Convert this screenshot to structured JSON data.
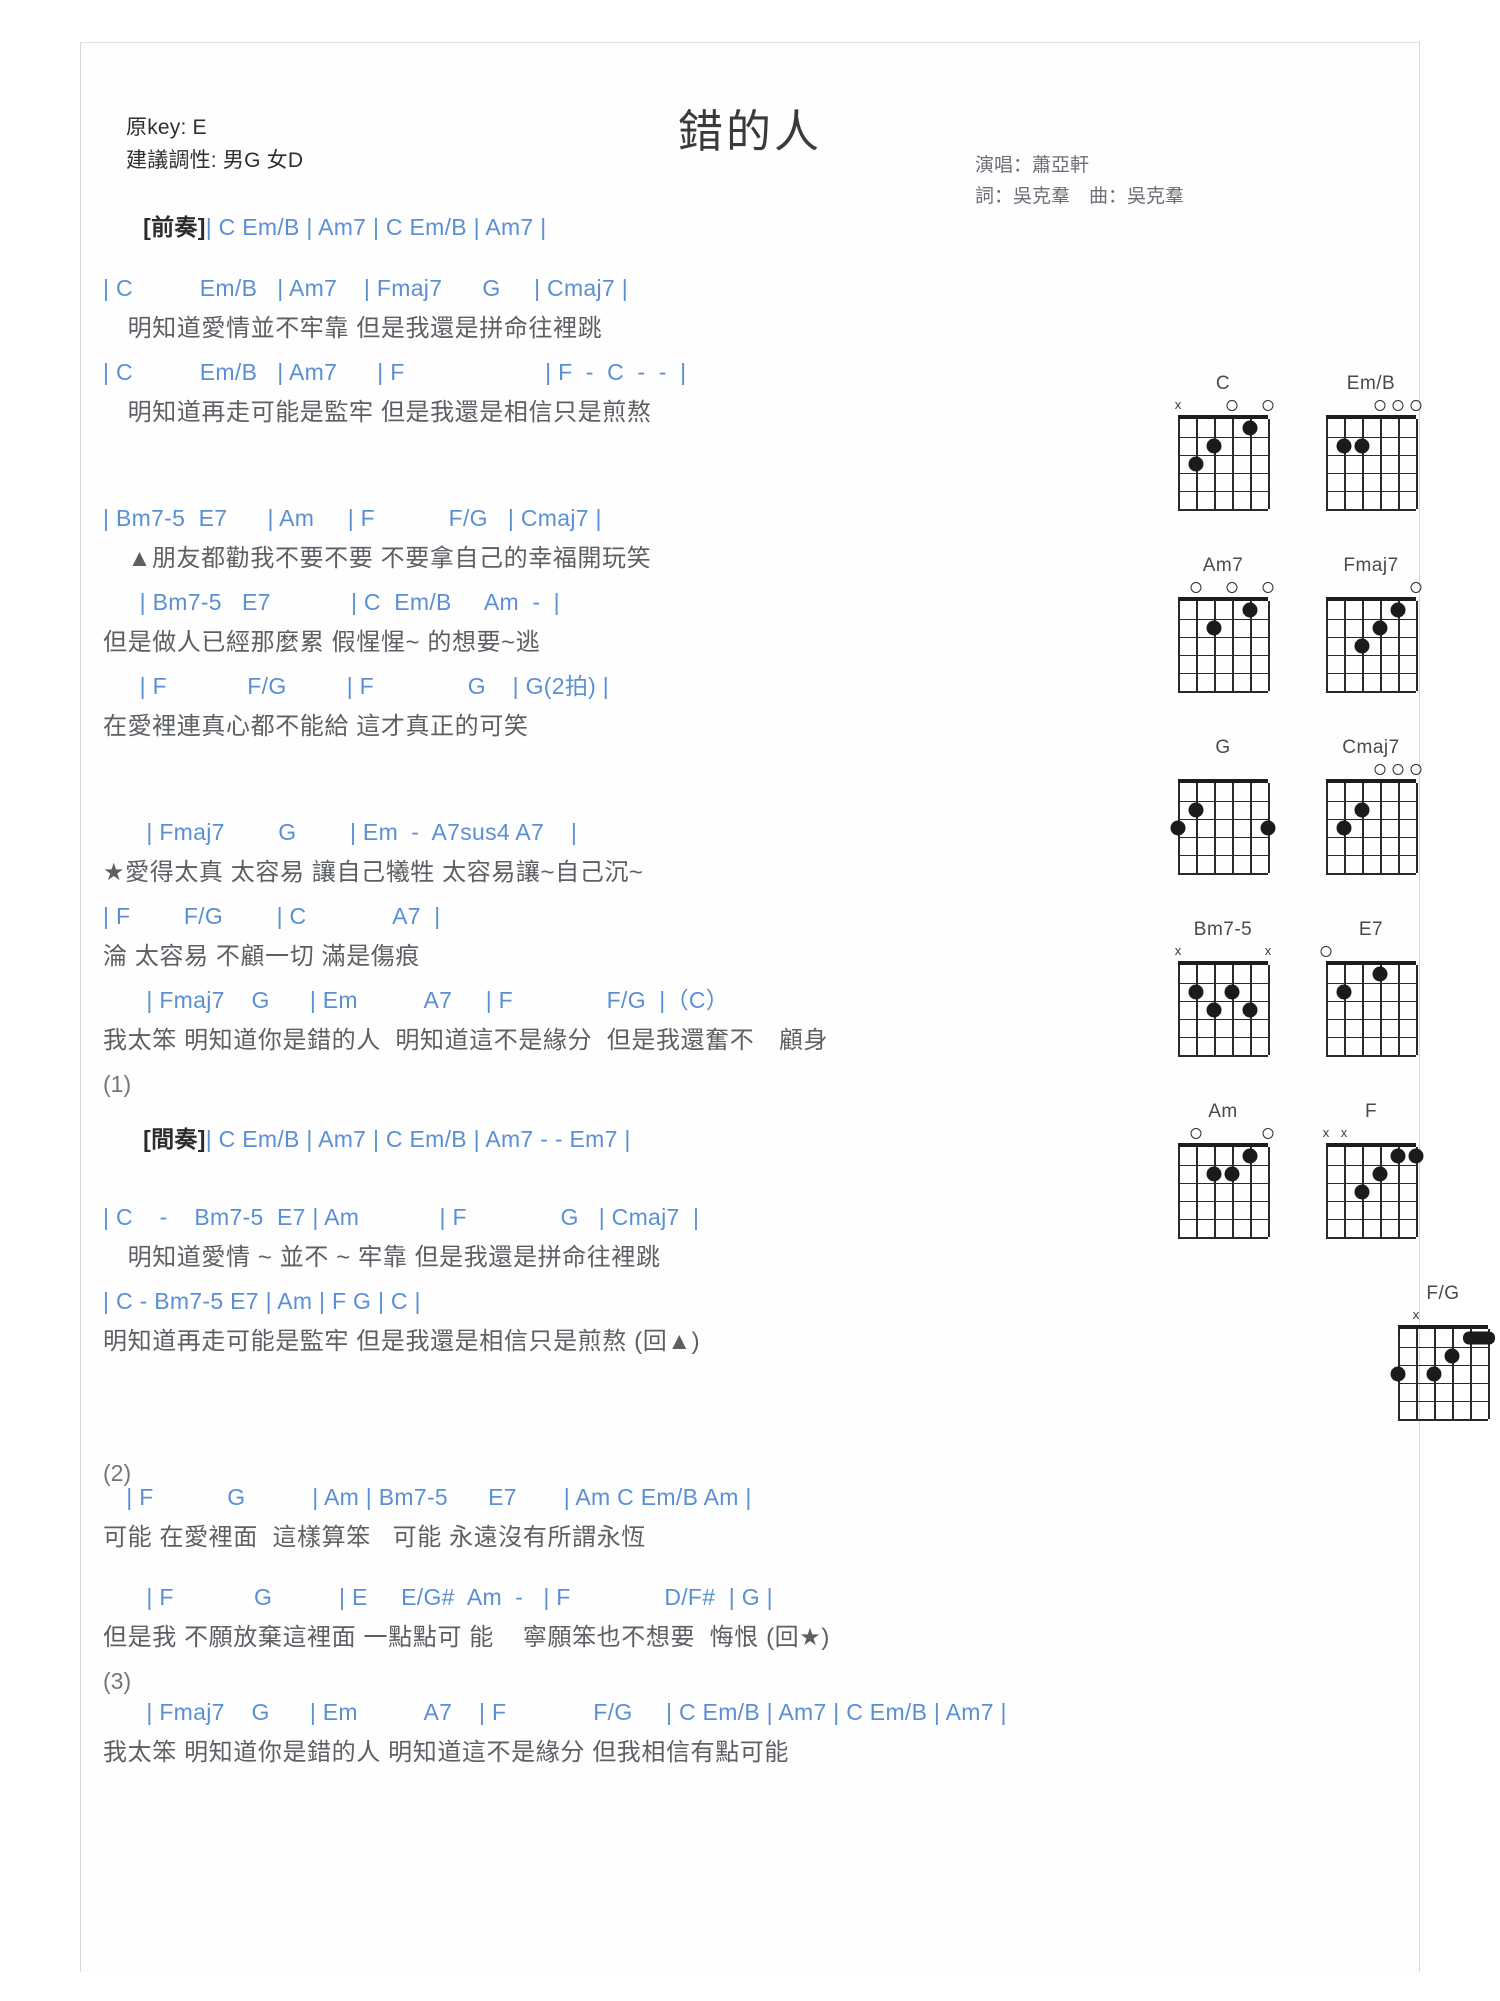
{
  "header": {
    "orig_key": "原key: E",
    "suggested_key": "建議調性: 男G 女D",
    "title": "錯的人",
    "singer": "演唱：蕭亞軒",
    "writer": "詞：吳克羣　曲：吳克羣"
  },
  "sections": [
    {
      "id": "intro",
      "tag": "[前奏]",
      "chords": "| C Em/B | Am7 | C Em/B | Am7 |"
    }
  ],
  "verse1": {
    "chords_1": "| C          Em/B   | Am7    | Fmaj7      G     | Cmaj7 |",
    "lyric_1": "　明知道愛情並不牢靠 但是我還是拼命往裡跳",
    "chords_2": "| C          Em/B   | Am7      | F                     | F  -  C  -  -  |",
    "lyric_2": "　明知道再走可能是監牢 但是我還是相信只是煎熬"
  },
  "verse2": {
    "chords_1": "| Bm7-5  E7      | Am     | F           F/G   | Cmaj7 |",
    "lyric_1": "　▲朋友都勸我不要不要 不要拿自己的幸福開玩笑",
    "chords_2": "　  | Bm7-5   E7            | C  Em/B     Am  -  |",
    "lyric_2": "但是做人已經那麼累 假惺惺~ 的想要~逃",
    "chords_3": "　  | F            F/G         | F              G    | G(2拍) |",
    "lyric_3": "在愛裡連真心都不能給 這才真正的可笑"
  },
  "chorus": {
    "chords_1": "　   | Fmaj7        G        | Em  -  A7sus4 A7    |",
    "lyric_1": "★愛得太真 太容易 讓自己犧牲 太容易讓~自己沉~",
    "chords_2": "| F        F/G        | C             A7  |",
    "lyric_2": "淪 太容易 不顧一切 滿是傷痕",
    "chords_3": "　   | Fmaj7    G      | Em          A7     | F              F/G  |（C）",
    "lyric_3": "我太笨 明知道你是錯的人  明知道這不是緣分  但是我還奮不　顧身",
    "marker_1": "(1)"
  },
  "interlude": {
    "tag": "[間奏]",
    "chords": "| C Em/B | Am7 | C Em/B | Am7 - - Em7 |"
  },
  "verse3": {
    "chords_1": "| C    -    Bm7-5  E7 | Am            | F              G   | Cmaj7  |",
    "lyric_1": "　明知道愛情 ~ 並不 ~ 牢靠 但是我還是拼命往裡跳",
    "chords_2": "| C - Bm7-5 E7 | Am | F G | C |",
    "lyric_2": "明知道再走可能是監牢 但是我還是相信只是煎熬 (回▲)"
  },
  "verse4": {
    "marker_2": "(2)",
    "chords_1": "　| F           G          | Am | Bm7-5      E7       | Am C Em/B Am |",
    "lyric_1": "可能 在愛裡面  這樣算笨   可能 永遠沒有所謂永恆",
    "chords_2": "　   | F            G          | E     E/G#  Am  -   | F              D/F#  | G |",
    "lyric_2": "但是我 不願放棄這裡面 一點點可 能    寧願笨也不想要  悔恨 (回★)",
    "marker_3": "(3)"
  },
  "ending": {
    "chords_1": "　   | Fmaj7    G      | Em          A7    | F             F/G     | C Em/B | Am7 | C Em/B | Am7 |",
    "lyric_1": "我太笨 明知道你是錯的人 明知道這不是緣分 但我相信有點可能"
  },
  "colors": {
    "chord": "#5b8fd4",
    "lyric": "#5c5f63",
    "bar": "#c9a227",
    "bar_alt": "#8d9a6b",
    "title": "#3a3a3a",
    "credits": "#6c6f77"
  },
  "chord_diagrams": [
    {
      "name": "C",
      "name_html": "C",
      "markers": [
        {
          "string": 6,
          "type": "x"
        },
        {
          "string": 3,
          "type": "o"
        },
        {
          "string": 1,
          "type": "o"
        }
      ],
      "dots": [
        {
          "string": 2,
          "fret": 1
        },
        {
          "string": 4,
          "fret": 2
        },
        {
          "string": 5,
          "fret": 3
        }
      ],
      "barres": []
    },
    {
      "name": "Em/B",
      "name_html": "Em/B",
      "markers": [
        {
          "string": 3,
          "type": "o"
        },
        {
          "string": 2,
          "type": "o"
        },
        {
          "string": 1,
          "type": "o"
        }
      ],
      "dots": [
        {
          "string": 5,
          "fret": 2
        },
        {
          "string": 4,
          "fret": 2
        }
      ],
      "barres": []
    },
    {
      "name": "Am7",
      "name_html": "Am7",
      "markers": [
        {
          "string": 5,
          "type": "o"
        },
        {
          "string": 3,
          "type": "o"
        },
        {
          "string": 1,
          "type": "o"
        }
      ],
      "dots": [
        {
          "string": 4,
          "fret": 2
        },
        {
          "string": 2,
          "fret": 1
        }
      ],
      "barres": []
    },
    {
      "name": "Fmaj7",
      "name_html": "Fmaj7",
      "markers": [
        {
          "string": 1,
          "type": "o"
        }
      ],
      "dots": [
        {
          "string": 4,
          "fret": 3
        },
        {
          "string": 3,
          "fret": 2
        },
        {
          "string": 2,
          "fret": 1
        }
      ],
      "barres": []
    },
    {
      "name": "G",
      "name_html": "G",
      "markers": [],
      "dots": [
        {
          "string": 5,
          "fret": 2
        },
        {
          "string": 6,
          "fret": 3
        },
        {
          "string": 1,
          "fret": 3
        }
      ],
      "barres": []
    },
    {
      "name": "Cmaj7",
      "name_html": "Cmaj7",
      "markers": [
        {
          "string": 3,
          "type": "o"
        },
        {
          "string": 2,
          "type": "o"
        },
        {
          "string": 1,
          "type": "o"
        }
      ],
      "dots": [
        {
          "string": 5,
          "fret": 3
        },
        {
          "string": 4,
          "fret": 2
        }
      ],
      "barres": []
    },
    {
      "name": "Bm7-5",
      "name_html": "Bm7-5",
      "markers": [
        {
          "string": 6,
          "type": "x"
        },
        {
          "string": 1,
          "type": "x"
        }
      ],
      "dots": [
        {
          "string": 5,
          "fret": 2
        },
        {
          "string": 3,
          "fret": 2
        },
        {
          "string": 4,
          "fret": 3
        },
        {
          "string": 2,
          "fret": 3
        }
      ],
      "barres": []
    },
    {
      "name": "E7",
      "name_html": "E7",
      "markers": [
        {
          "string": 6,
          "type": "o"
        }
      ],
      "dots": [
        {
          "string": 5,
          "fret": 2
        },
        {
          "string": 3,
          "fret": 1
        }
      ],
      "barres": []
    },
    {
      "name": "Am",
      "name_html": "Am",
      "markers": [
        {
          "string": 5,
          "type": "o"
        },
        {
          "string": 1,
          "type": "o"
        }
      ],
      "dots": [
        {
          "string": 4,
          "fret": 2
        },
        {
          "string": 3,
          "fret": 2
        },
        {
          "string": 2,
          "fret": 1
        }
      ],
      "barres": []
    },
    {
      "name": "F",
      "name_html": "F",
      "markers": [
        {
          "string": 6,
          "type": "x"
        },
        {
          "string": 5,
          "type": "x"
        }
      ],
      "dots": [
        {
          "string": 4,
          "fret": 3
        },
        {
          "string": 3,
          "fret": 2
        },
        {
          "string": 2,
          "fret": 1
        },
        {
          "string": 1,
          "fret": 1
        }
      ],
      "barres": []
    },
    {
      "name": "F/G",
      "name_html": "F/G",
      "markers": [
        {
          "string": 5,
          "type": "x"
        }
      ],
      "dots": [
        {
          "string": 6,
          "fret": 3
        },
        {
          "string": 4,
          "fret": 3
        },
        {
          "string": 3,
          "fret": 2
        }
      ],
      "barres": [
        {
          "fret": 1,
          "from": 2,
          "to": 1
        }
      ]
    }
  ]
}
